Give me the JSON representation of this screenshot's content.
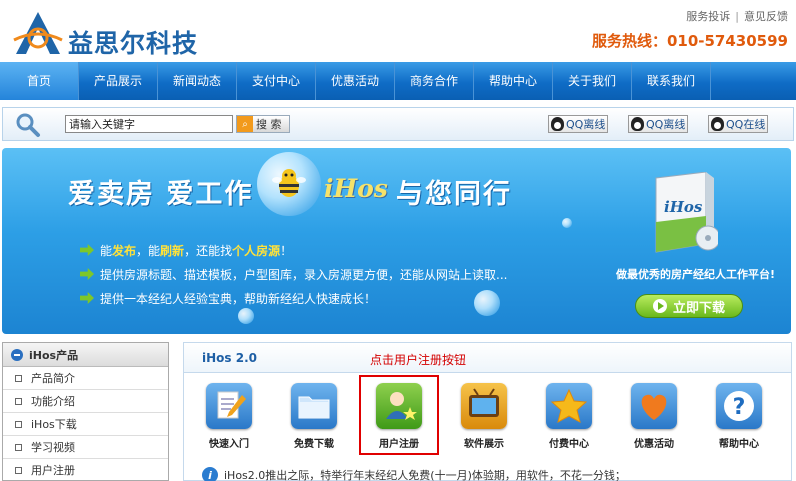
{
  "header": {
    "logo_text": "益思尔科技",
    "links": [
      "服务投诉",
      "意见反馈"
    ],
    "hotline": "服务热线：010-57430599"
  },
  "nav": {
    "items": [
      "首页",
      "产品展示",
      "新闻动态",
      "支付中心",
      "优惠活动",
      "商务合作",
      "帮助中心",
      "关于我们",
      "联系我们"
    ],
    "active_index": 0
  },
  "search": {
    "value": "请输入关键字",
    "button_label": "搜 索",
    "qq_buttons": [
      "QQ离线",
      "QQ离线",
      "QQ在线"
    ]
  },
  "banner": {
    "title_left": "爱卖房 爱工作",
    "title_brand": "iHos",
    "title_right": "与您同行",
    "bullets": [
      {
        "pre": "能",
        "h1": "发布",
        "mid": "，能",
        "h2": "刷新",
        "post": "，还能找",
        "h3": "个人房源",
        "end": "！"
      },
      {
        "text": "提供房源标题、描述模板，户型图库，录入房源更方便，还能从网站上读取..."
      },
      {
        "text": "提供一本经纪人经验宝典，帮助新经纪人快速成长！"
      }
    ],
    "box_label": "iHos",
    "slogan": "做最优秀的房产经纪人工作平台!",
    "download_label": "立即下载"
  },
  "sidebar": {
    "title": "iHos产品",
    "items": [
      "产品简介",
      "功能介绍",
      "iHos下载",
      "学习视频",
      "用户注册"
    ]
  },
  "main": {
    "tab_title": "iHos 2.0",
    "annotation": "点击用户注册按钮",
    "icons": [
      {
        "label": "快速入门",
        "icon": "notepad-pencil-icon",
        "color": "#3d8ed8"
      },
      {
        "label": "免费下载",
        "icon": "folder-icon",
        "color": "#2e86d0"
      },
      {
        "label": "用户注册",
        "icon": "user-add-icon",
        "color": "#5cae2a"
      },
      {
        "label": "软件展示",
        "icon": "tv-icon",
        "color": "#e8a21a"
      },
      {
        "label": "付费中心",
        "icon": "star-icon",
        "color": "#2a8fd8"
      },
      {
        "label": "优惠活动",
        "icon": "heart-icon",
        "color": "#2a8fd8"
      },
      {
        "label": "帮助中心",
        "icon": "question-icon",
        "color": "#2a8fd8"
      }
    ],
    "info_text": "iHos2.0推出之际，特举行年末经纪人免费(十一月)体验期，用软件，不花一分钱；"
  }
}
